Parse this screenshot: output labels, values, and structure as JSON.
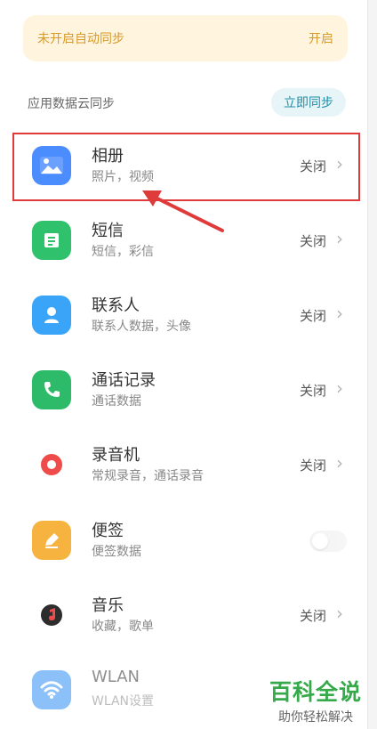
{
  "banner": {
    "text": "未开启自动同步",
    "action": "开启"
  },
  "section": {
    "label": "应用数据云同步",
    "sync_button": "立即同步"
  },
  "items": [
    {
      "title": "相册",
      "subtitle": "照片，视频",
      "status": "关闭",
      "icon": "gallery-icon",
      "color": "#4b8cff"
    },
    {
      "title": "短信",
      "subtitle": "短信，彩信",
      "status": "关闭",
      "icon": "message-icon",
      "color": "#2fc16b"
    },
    {
      "title": "联系人",
      "subtitle": "联系人数据，头像",
      "status": "关闭",
      "icon": "contacts-icon",
      "color": "#3aa5f8"
    },
    {
      "title": "通话记录",
      "subtitle": "通话数据",
      "status": "关闭",
      "icon": "phone-icon",
      "color": "#2dbb69"
    },
    {
      "title": "录音机",
      "subtitle": "常规录音，通话录音",
      "status": "关闭",
      "icon": "recorder-icon",
      "color": "#ef4b4b"
    },
    {
      "title": "便签",
      "subtitle": "便签数据",
      "status": "",
      "icon": "note-icon",
      "color": "#f6b33f"
    },
    {
      "title": "音乐",
      "subtitle": "收藏，歌单",
      "status": "关闭",
      "icon": "music-icon",
      "color": "#2d2d2d"
    },
    {
      "title": "WLAN",
      "subtitle": "WLAN设置",
      "status": "",
      "icon": "wifi-icon",
      "color": "#2d8ff3"
    }
  ],
  "watermark": {
    "title": "百科全说",
    "subtitle": "助你轻松解决"
  }
}
